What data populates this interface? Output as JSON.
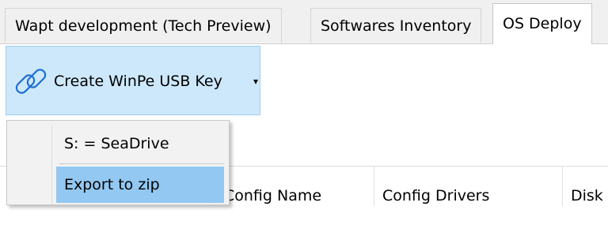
{
  "tabs": [
    {
      "label": "Wapt development (Tech Preview)"
    },
    {
      "label": "Softwares Inventory"
    },
    {
      "label": "OS Deploy"
    }
  ],
  "toolbar": {
    "create_winpe_label": "Create WinPe USB Key",
    "create_winpe_icon": "link-icon",
    "dropdown_arrow": "▾"
  },
  "dropdown_menu": {
    "items": [
      {
        "label": "S: = SeaDrive",
        "highlighted": false
      },
      {
        "label": "Export to zip",
        "highlighted": true
      }
    ]
  },
  "grid": {
    "columns": [
      {
        "label": "Config Name"
      },
      {
        "label": "Config Drivers"
      },
      {
        "label": "Disk"
      }
    ]
  },
  "colors": {
    "button_bg": "#cde8fb",
    "menu_highlight": "#92c8f2",
    "link_icon": "#1f6fd1"
  }
}
